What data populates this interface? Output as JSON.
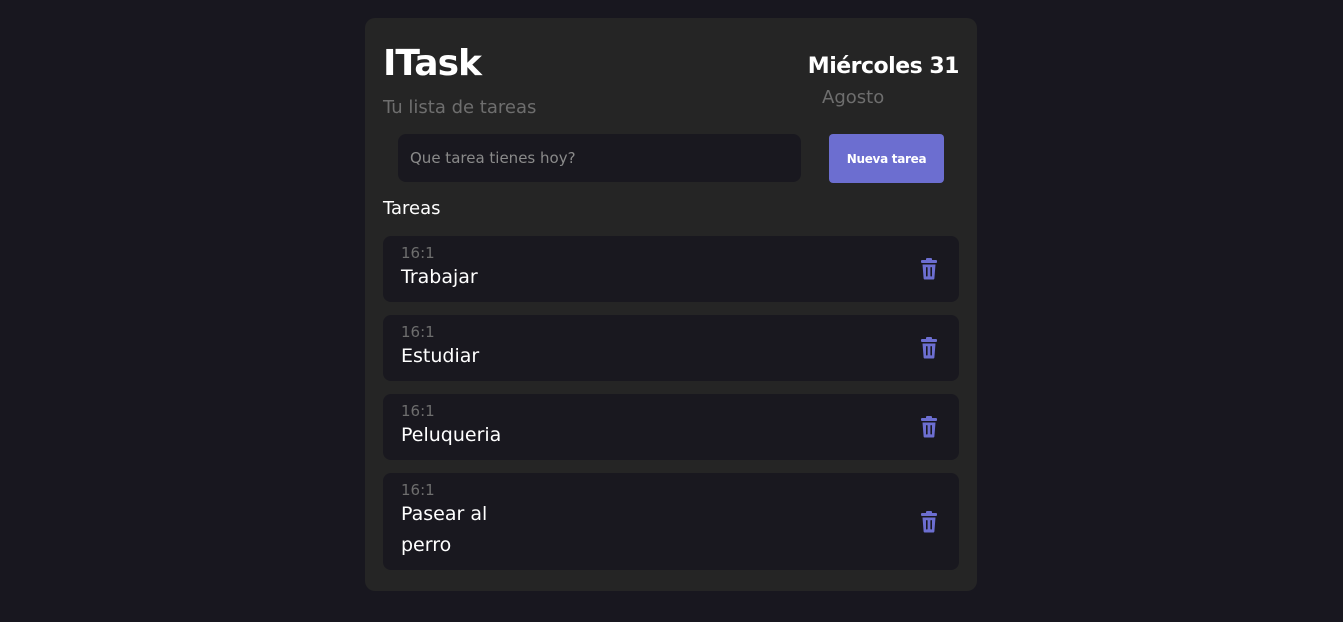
{
  "header": {
    "title": "ITask",
    "subtitle": "Tu lista de tareas",
    "day": "Miércoles 31",
    "month": "Agosto"
  },
  "form": {
    "placeholder": "Que tarea tienes hoy?",
    "value": "",
    "button_label": "Nueva tarea"
  },
  "section": {
    "label": "Tareas"
  },
  "tasks": [
    {
      "time": "16:1",
      "text": "Trabajar"
    },
    {
      "time": "16:1",
      "text": "Estudiar"
    },
    {
      "time": "16:1",
      "text": "Peluqueria"
    },
    {
      "time": "16:1",
      "text": "Pasear al perro"
    }
  ],
  "icons": {
    "delete": "trash-icon"
  },
  "colors": {
    "background": "#18171f",
    "card": "#252525",
    "item": "#19181f",
    "accent": "#6c6ed0",
    "muted": "#6e6e6e",
    "text": "#ffffff"
  }
}
